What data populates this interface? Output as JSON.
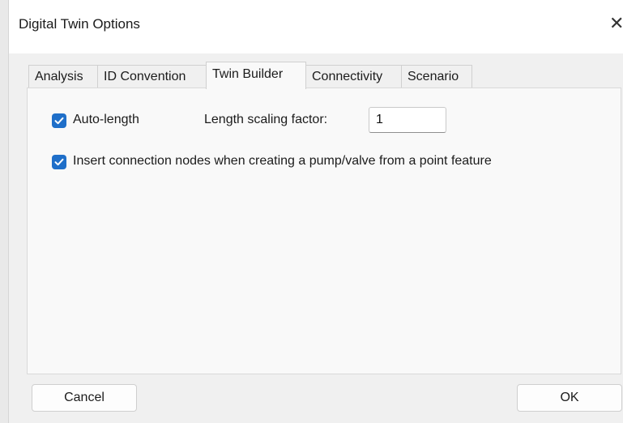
{
  "window": {
    "title": "Digital Twin Options",
    "close_glyph": "✕"
  },
  "tabs": [
    {
      "label": "Analysis",
      "active": false
    },
    {
      "label": "ID Convention",
      "active": false
    },
    {
      "label": "Twin Builder",
      "active": true
    },
    {
      "label": "Connectivity",
      "active": false
    },
    {
      "label": "Scenario",
      "active": false
    }
  ],
  "twin_builder": {
    "auto_length": {
      "label": "Auto-length",
      "checked": true
    },
    "length_scaling": {
      "label": "Length scaling factor:",
      "value": "1"
    },
    "insert_nodes": {
      "label": "Insert connection nodes when creating a pump/valve from a point feature",
      "checked": true
    }
  },
  "buttons": {
    "cancel": "Cancel",
    "ok": "OK"
  },
  "colors": {
    "checkbox_accent": "#1f6fc9",
    "panel_bg": "#f9f9f9",
    "window_bg": "#f0f0f0"
  }
}
